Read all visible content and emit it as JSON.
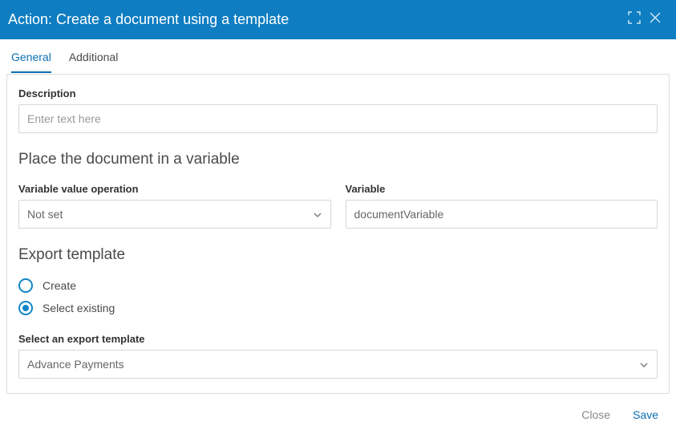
{
  "header": {
    "title": "Action: Create a document using a template"
  },
  "tabs": {
    "general": "General",
    "additional": "Additional"
  },
  "description": {
    "label": "Description",
    "placeholder": "Enter text here",
    "value": ""
  },
  "section_variable": {
    "title": "Place the document in a variable",
    "operation_label": "Variable value operation",
    "operation_value": "Not set",
    "variable_label": "Variable",
    "variable_value": "documentVariable"
  },
  "section_export": {
    "title": "Export template",
    "radio_create": "Create",
    "radio_select_existing": "Select existing",
    "select_label": "Select an export template",
    "select_value": "Advance Payments"
  },
  "footer": {
    "close": "Close",
    "save": "Save"
  }
}
